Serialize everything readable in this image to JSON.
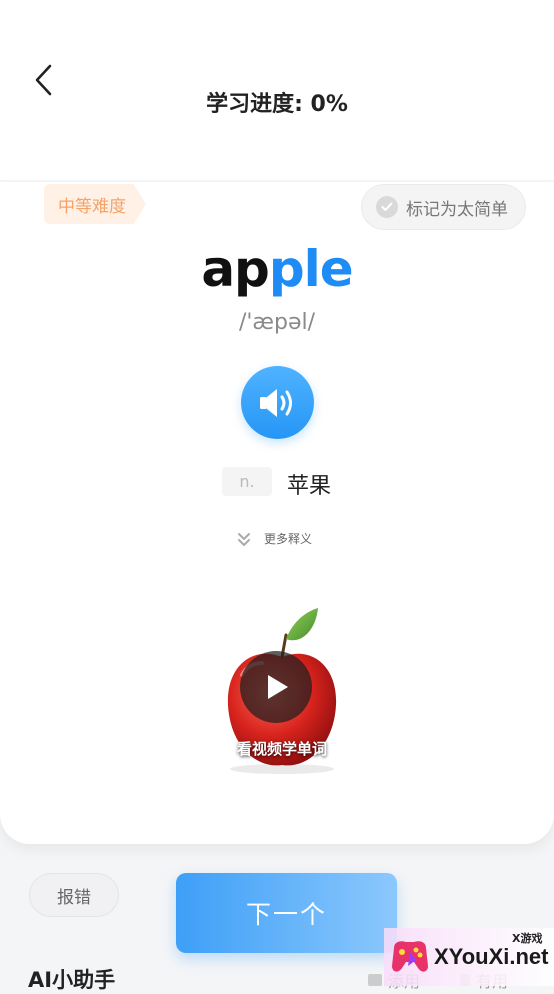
{
  "header": {
    "title": "学习进度: 0%"
  },
  "card": {
    "difficulty": "中等难度",
    "mark_easy_label": "标记为太简单",
    "word_part1": "ap",
    "word_part2": "ple",
    "phonetic": "/'æpəl/",
    "part_of_speech": "n.",
    "meaning": "苹果",
    "more_definitions": "更多释义",
    "video_caption": "看视频学单词"
  },
  "footer": {
    "report_label": "报错",
    "next_label": "下一个",
    "ai_label": "AI小助手",
    "tool_1": "添用",
    "tool_2": "有用"
  },
  "watermark": {
    "brand": "XYouXi.net",
    "sup": "X游戏"
  },
  "colors": {
    "accent": "#1f8bf5",
    "difficulty_bg": "#fff1e6",
    "difficulty_text": "#f5a26a"
  }
}
